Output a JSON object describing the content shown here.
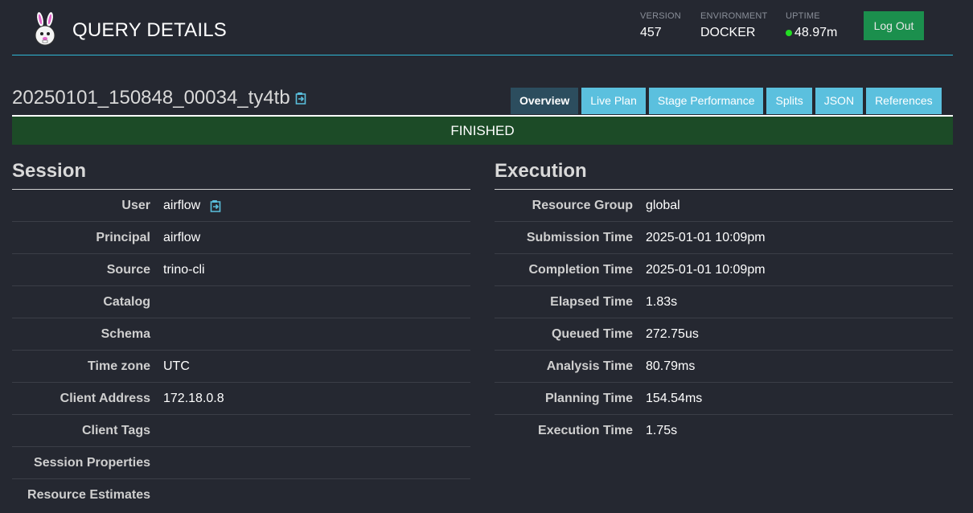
{
  "header": {
    "title": "QUERY DETAILS",
    "version_label": "VERSION",
    "version_value": "457",
    "environment_label": "ENVIRONMENT",
    "environment_value": "DOCKER",
    "uptime_label": "UPTIME",
    "uptime_value": "48.97m",
    "logout_label": "Log Out"
  },
  "query": {
    "id": "20250101_150848_00034_ty4tb",
    "state": "FINISHED"
  },
  "tabs": [
    {
      "label": "Overview",
      "active": true
    },
    {
      "label": "Live Plan",
      "active": false
    },
    {
      "label": "Stage Performance",
      "active": false
    },
    {
      "label": "Splits",
      "active": false
    },
    {
      "label": "JSON",
      "active": false
    },
    {
      "label": "References",
      "active": false
    }
  ],
  "session": {
    "title": "Session",
    "rows": [
      {
        "label": "User",
        "value": "airflow"
      },
      {
        "label": "Principal",
        "value": "airflow"
      },
      {
        "label": "Source",
        "value": "trino-cli"
      },
      {
        "label": "Catalog",
        "value": ""
      },
      {
        "label": "Schema",
        "value": ""
      },
      {
        "label": "Time zone",
        "value": "UTC"
      },
      {
        "label": "Client Address",
        "value": "172.18.0.8"
      },
      {
        "label": "Client Tags",
        "value": ""
      },
      {
        "label": "Session Properties",
        "value": ""
      },
      {
        "label": "Resource Estimates",
        "value": ""
      }
    ]
  },
  "execution": {
    "title": "Execution",
    "rows": [
      {
        "label": "Resource Group",
        "value": "global"
      },
      {
        "label": "Submission Time",
        "value": "2025-01-01 10:09pm"
      },
      {
        "label": "Completion Time",
        "value": "2025-01-01 10:09pm"
      },
      {
        "label": "Elapsed Time",
        "value": "1.83s"
      },
      {
        "label": "Queued Time",
        "value": "272.75us"
      },
      {
        "label": "Analysis Time",
        "value": "80.79ms"
      },
      {
        "label": "Planning Time",
        "value": "154.54ms"
      },
      {
        "label": "Execution Time",
        "value": "1.75s"
      }
    ]
  },
  "colors": {
    "background": "#252831",
    "accent_line": "#2fb8d6",
    "tab": "#5bc0de",
    "tab_active": "#2c4d5e",
    "status_finished": "#1c4b27",
    "logout": "#1b8f4d",
    "uptime_dot": "#22dd22"
  },
  "icons": {
    "logo": "trino-bunny-logo",
    "copy": "clipboard-copy-icon"
  }
}
